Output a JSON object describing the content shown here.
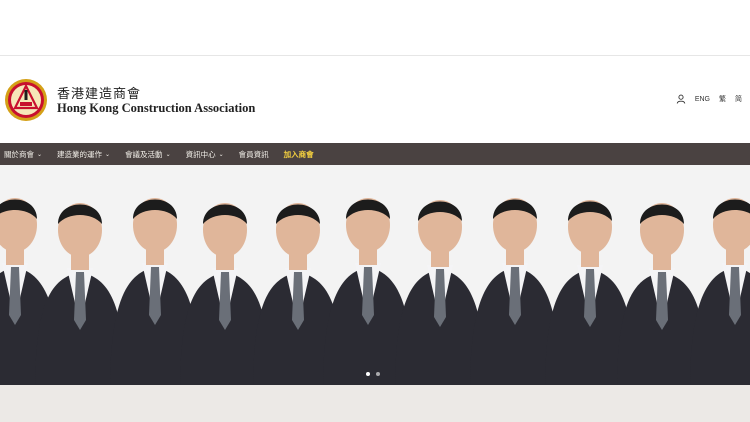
{
  "header": {
    "brand_zh": "香港建造商會",
    "brand_en": "Hong Kong Construction Association"
  },
  "utility": {
    "user_icon": "user-icon",
    "lang_eng": "ENG",
    "lang_trad": "繁",
    "lang_simp": "简"
  },
  "nav": {
    "items": [
      {
        "label": "關於商會",
        "has_dropdown": true
      },
      {
        "label": "建造業的運作",
        "has_dropdown": true
      },
      {
        "label": "會議及活動",
        "has_dropdown": true
      },
      {
        "label": "資訊中心",
        "has_dropdown": true
      },
      {
        "label": "會員資訊",
        "has_dropdown": false
      },
      {
        "label": "加入商會",
        "has_dropdown": false,
        "highlight": true
      }
    ],
    "chevron": "⌄"
  },
  "hero": {
    "description_colors": {
      "suit": "#2b2b33",
      "shirt": "#f4f4f6",
      "tie": "#6a6f78",
      "skin": "#e0b69a",
      "hair": "#1c1c1c"
    },
    "slide_count": 2,
    "active_slide": 1
  },
  "colors": {
    "nav_bg": "#4a4241",
    "nav_highlight": "#f4d03f",
    "logo_red": "#c8102e",
    "logo_gold": "#d4a017"
  }
}
